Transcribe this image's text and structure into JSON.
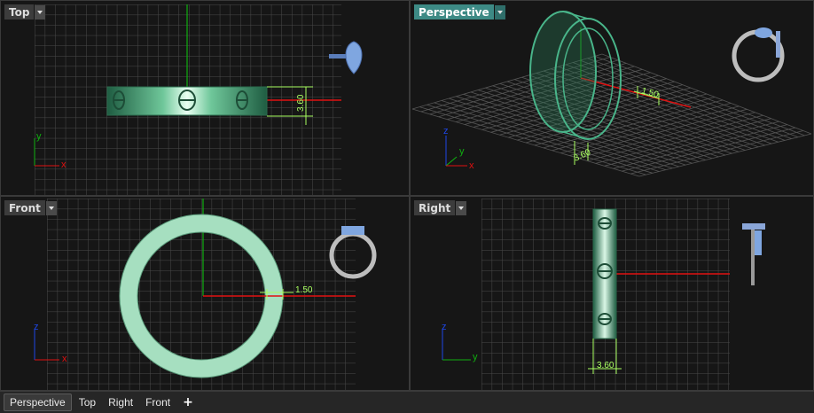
{
  "viewports": {
    "top": {
      "label": "Top",
      "dimension": "3.60"
    },
    "perspective": {
      "label": "Perspective",
      "dimension": "1.50",
      "dimension_small": "3.60"
    },
    "front": {
      "label": "Front",
      "dimension": "1.50"
    },
    "right": {
      "label": "Right",
      "dimension": "3.60"
    }
  },
  "axes": {
    "x": "x",
    "y": "y",
    "z": "z"
  },
  "bottom_tabs": [
    {
      "label": "Perspective",
      "active": true
    },
    {
      "label": "Top"
    },
    {
      "label": "Right"
    },
    {
      "label": "Front"
    }
  ],
  "add_tab_label": "+",
  "colors": {
    "ring": "#3f8d69",
    "grid": "#4a4a4a",
    "x_axis": "#e01010",
    "y_axis": "#10b010",
    "dimension": "#a8ff60",
    "active_tab": "#3d8a85"
  }
}
